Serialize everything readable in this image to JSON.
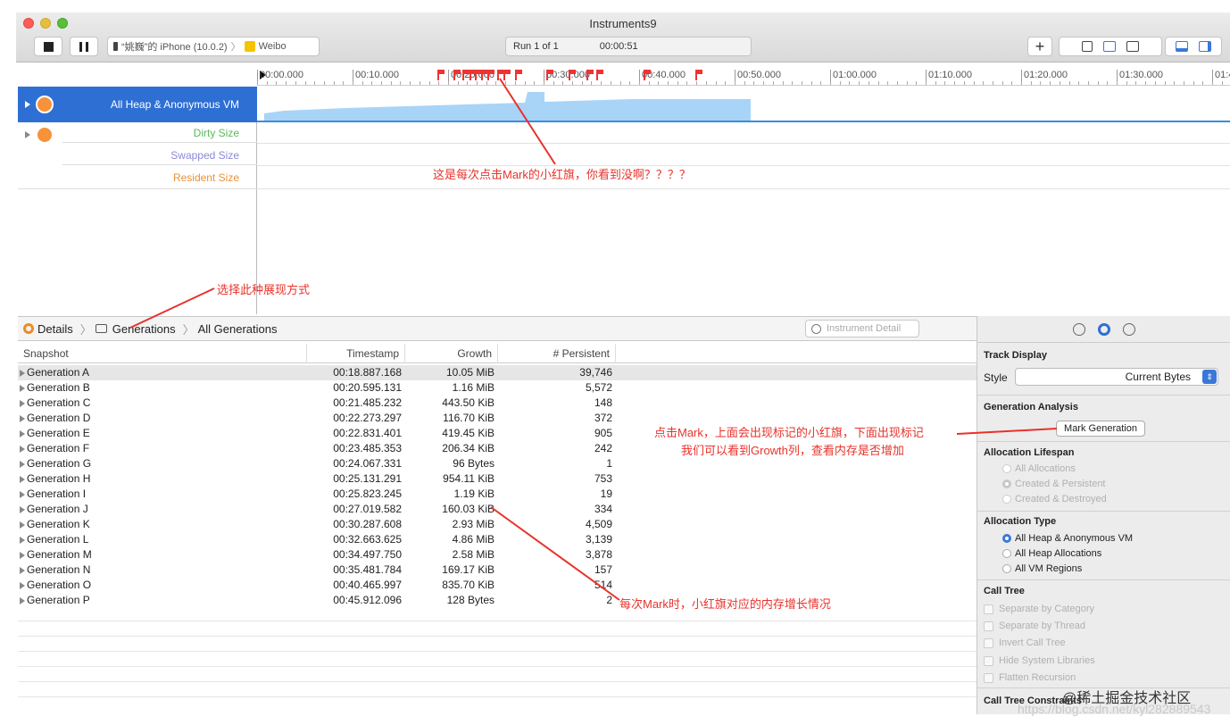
{
  "window": {
    "title": "Instruments9",
    "device": "“姚巍”的 iPhone (10.0.2)",
    "target": "Weibo",
    "run": "Run 1 of 1",
    "elapsed": "00:00:51",
    "add_symbol": "+"
  },
  "ruler": {
    "ticks": [
      "00:00.000",
      "00:10.000",
      "00:20.000",
      "00:30.000",
      "00:40.000",
      "00:50.000",
      "01:00.000",
      "01:10.000",
      "01:20.000",
      "01:30.000",
      "01:4"
    ]
  },
  "tracks": {
    "heap": "All Heap & Anonymous VM",
    "dirty": "Dirty Size",
    "swapped": "Swapped Size",
    "resident": "Resident Size",
    "colors": {
      "dirty": "#5cb85c",
      "swapped": "#8a8ad8",
      "resident": "#e8913a",
      "heap_bg": "#2e6fd4",
      "graph": "#a8d4f8"
    }
  },
  "annotations": {
    "flags_note": "这是每次点击Mark的小红旗，你看到没啊？？？？",
    "display_note": "选择此种展现方式",
    "mark_note_1": "点击Mark，上面会出现标记的小红旗，下面出现标记",
    "mark_note_2": "我们可以看到Growth列，查看内存是否增加",
    "growth_note": "每次Mark时，小红旗对应的内存增长情况"
  },
  "breadcrumb": {
    "details": "Details",
    "generations": "Generations",
    "all": "All Generations",
    "search_placeholder": "Instrument Detail"
  },
  "table": {
    "headers": [
      "Snapshot",
      "Timestamp",
      "Growth",
      "# Persistent"
    ],
    "rows": [
      [
        "Generation A",
        "00:18.887.168",
        "10.05 MiB",
        "39,746"
      ],
      [
        "Generation B",
        "00:20.595.131",
        "1.16 MiB",
        "5,572"
      ],
      [
        "Generation C",
        "00:21.485.232",
        "443.50 KiB",
        "148"
      ],
      [
        "Generation D",
        "00:22.273.297",
        "116.70 KiB",
        "372"
      ],
      [
        "Generation E",
        "00:22.831.401",
        "419.45 KiB",
        "905"
      ],
      [
        "Generation F",
        "00:23.485.353",
        "206.34 KiB",
        "242"
      ],
      [
        "Generation G",
        "00:24.067.331",
        "96 Bytes",
        "1"
      ],
      [
        "Generation H",
        "00:25.131.291",
        "954.11 KiB",
        "753"
      ],
      [
        "Generation I",
        "00:25.823.245",
        "1.19 KiB",
        "19"
      ],
      [
        "Generation J",
        "00:27.019.582",
        "160.03 KiB",
        "334"
      ],
      [
        "Generation K",
        "00:30.287.608",
        "2.93 MiB",
        "4,509"
      ],
      [
        "Generation L",
        "00:32.663.625",
        "4.86 MiB",
        "3,139"
      ],
      [
        "Generation M",
        "00:34.497.750",
        "2.58 MiB",
        "3,878"
      ],
      [
        "Generation N",
        "00:35.481.784",
        "169.17 KiB",
        "157"
      ],
      [
        "Generation O",
        "00:40.465.997",
        "835.70 KiB",
        "514"
      ],
      [
        "Generation P",
        "00:45.912.096",
        "128 Bytes",
        "2"
      ]
    ]
  },
  "inspector": {
    "track_display": "Track Display",
    "style_label": "Style",
    "style_value": "Current Bytes",
    "generation_analysis": "Generation Analysis",
    "mark_generation": "Mark Generation",
    "allocation_lifespan": "Allocation Lifespan",
    "lifespan_options": [
      "All Allocations",
      "Created & Persistent",
      "Created & Destroyed"
    ],
    "allocation_type": "Allocation Type",
    "type_options": [
      "All Heap & Anonymous VM",
      "All Heap Allocations",
      "All VM Regions"
    ],
    "call_tree": "Call Tree",
    "call_tree_options": [
      "Separate by Category",
      "Separate by Thread",
      "Invert Call Tree",
      "Hide System Libraries",
      "Flatten Recursion"
    ],
    "call_tree_constraints": "Call Tree Constraints"
  },
  "watermark": {
    "text": "@稀土掘金技术社区",
    "url": "https://blog.csdn.net/kyl282889543"
  }
}
